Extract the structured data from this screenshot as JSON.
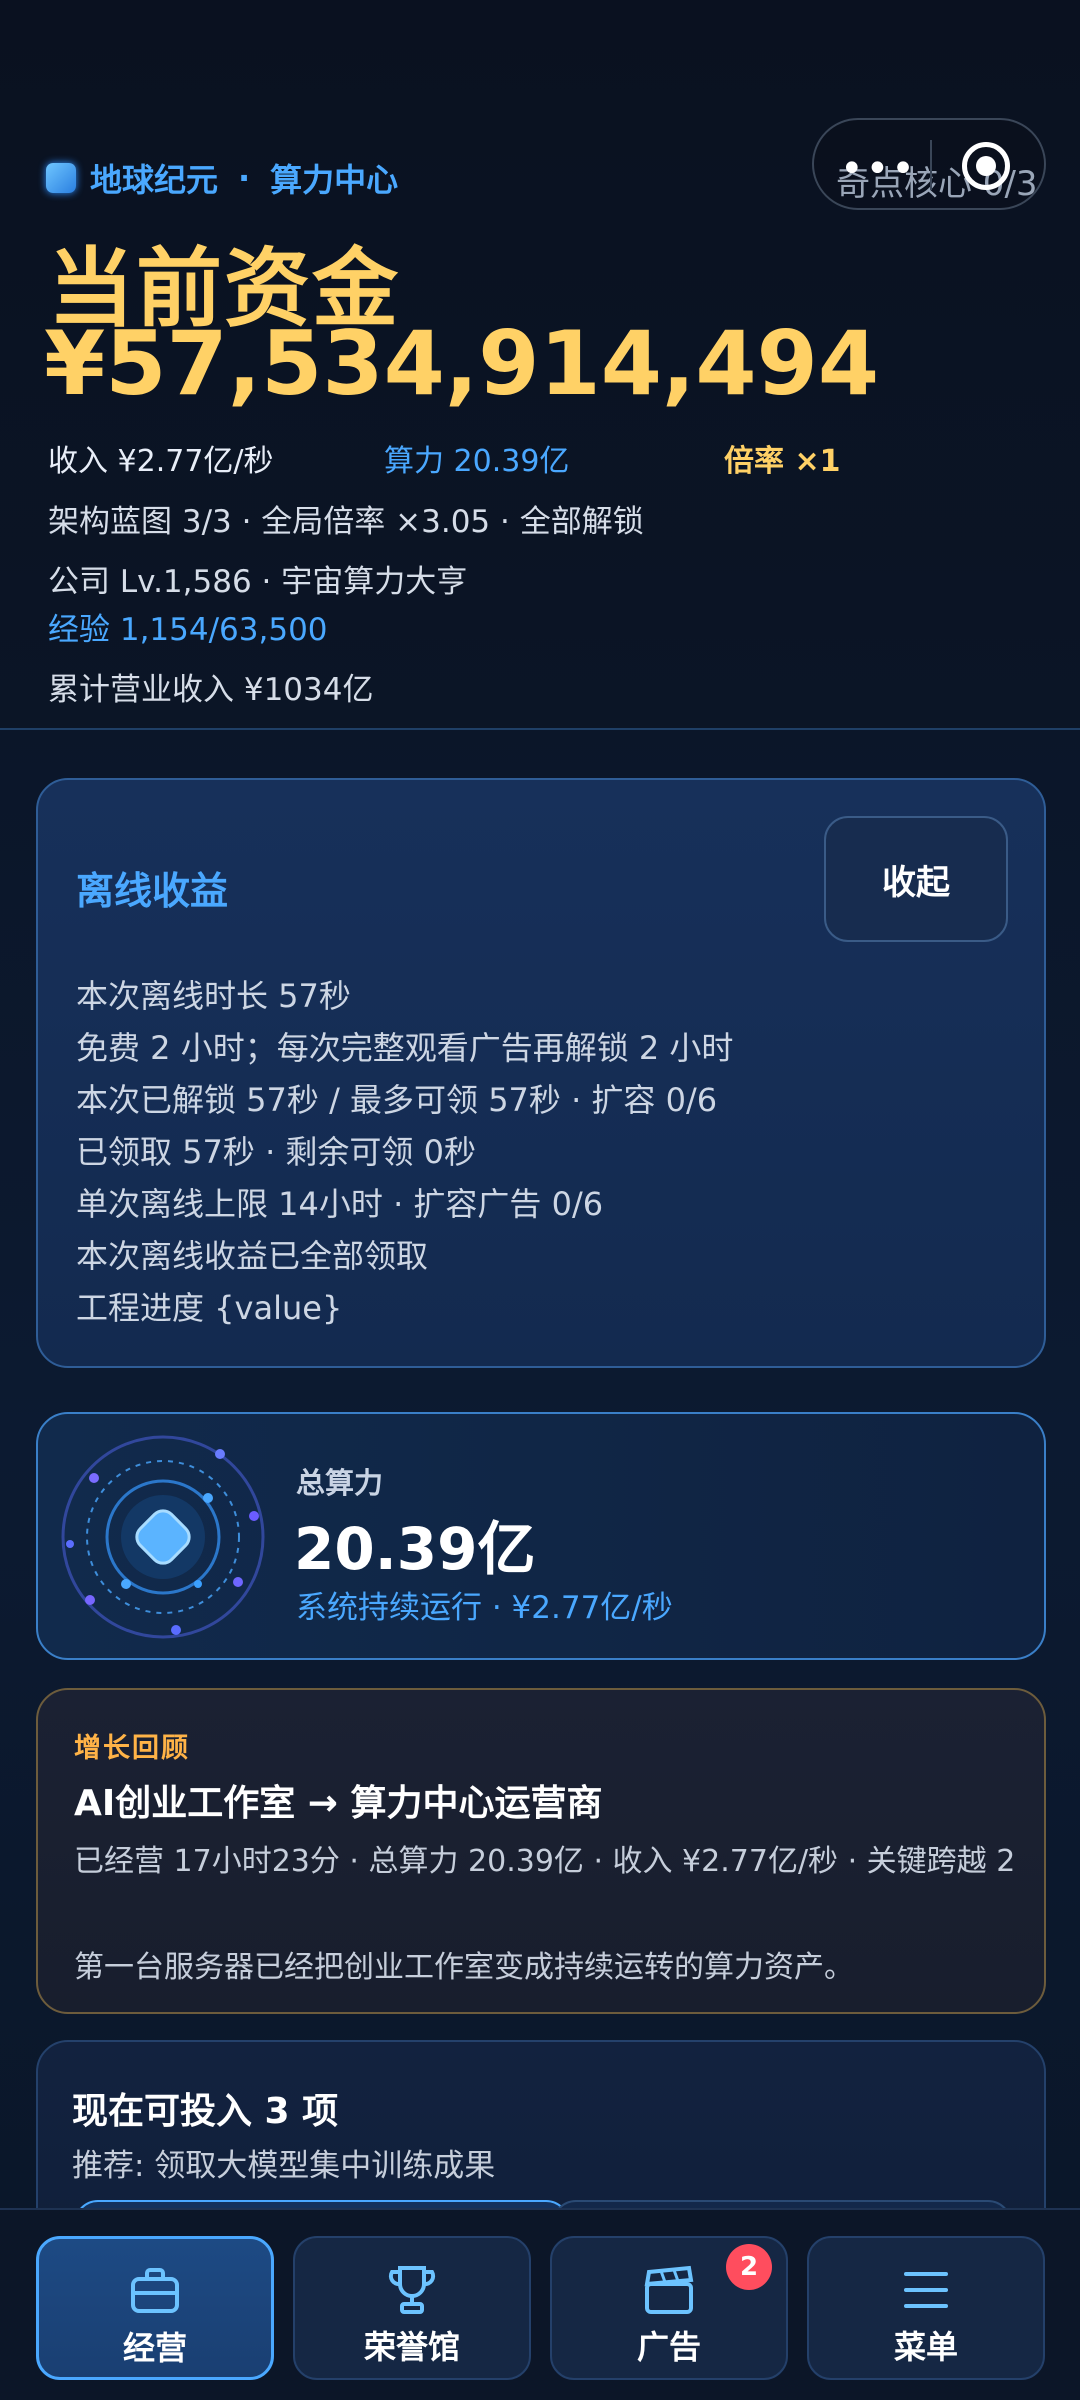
{
  "header": {
    "brand": "地球纪元",
    "separator": "·",
    "section": "算力中心",
    "capsule_label": "奇点核心 0/3",
    "funds_title": "当前资金",
    "funds_value": "¥57,534,914,494",
    "income": "收入 ¥2.77亿/秒",
    "power": "算力 20.39亿",
    "multiplier": "倍率 ×1",
    "blueprint_line": "架构蓝图 3/3 · 全局倍率 ×3.05 · 全部解锁",
    "company_line": "公司 Lv.1,586 · 宇宙算力大亨",
    "exp_line": "经验 1,154/63,500",
    "revenue_line": "累计营业收入 ¥1034亿"
  },
  "offline": {
    "title": "离线收益",
    "collapse_label": "收起",
    "lines": [
      "本次离线时长 57秒",
      "免费 2 小时；每次完整观看广告再解锁 2 小时",
      "本次已解锁 57秒 / 最多可领 57秒 · 扩容 0/6",
      "已领取 57秒 · 剩余可领 0秒",
      "单次离线上限 14小时 · 扩容广告 0/6",
      "本次离线收益已全部领取",
      "工程进度 {value}"
    ]
  },
  "power_card": {
    "label": "总算力",
    "value": "20.39亿",
    "sub": "系统持续运行 · ¥2.77亿/秒"
  },
  "growth": {
    "tag": "增长回顾",
    "title": "AI创业工作室 → 算力中心运营商",
    "stats": "已经营 17小时23分 · 总算力 20.39亿 · 收入 ¥2.77亿/秒 · 关键跨越 2",
    "desc": "第一台服务器已经把创业工作室变成持续运转的算力资产。"
  },
  "invest": {
    "title": "现在可投入 3 项",
    "recommend": "推荐: 领取大模型集中训练成果"
  },
  "nav": {
    "items": [
      {
        "label": "经营",
        "icon": "briefcase-icon",
        "active": true
      },
      {
        "label": "荣誉馆",
        "icon": "trophy-icon",
        "active": false
      },
      {
        "label": "广告",
        "icon": "clapperboard-icon",
        "active": false,
        "badge": "2"
      },
      {
        "label": "菜单",
        "icon": "menu-icon",
        "active": false
      }
    ]
  },
  "colors": {
    "gold": "#ffd166",
    "accent_blue": "#4aa8ff",
    "badge_red": "#ff4d5e",
    "growth_tag": "#ffb347"
  }
}
